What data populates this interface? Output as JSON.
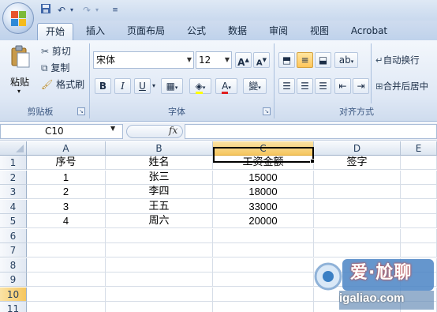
{
  "ribbon_tabs": [
    "开始",
    "插入",
    "页面布局",
    "公式",
    "数据",
    "审阅",
    "视图",
    "Acrobat"
  ],
  "active_tab": "开始",
  "clipboard": {
    "paste_label": "粘贴",
    "cut_label": "剪切",
    "copy_label": "复制",
    "format_painter_label": "格式刷",
    "group_label": "剪贴板"
  },
  "font": {
    "font_name": "宋体",
    "font_size": "12",
    "grow_label": "A",
    "shrink_label": "A",
    "bold": "B",
    "italic": "I",
    "underline": "U",
    "font_color_letter": "A",
    "phonetic_label": "變",
    "group_label": "字体"
  },
  "alignment": {
    "wrap_text_label": "自动换行",
    "merge_label": "合并后居中",
    "group_label": "对齐方式"
  },
  "formula_bar": {
    "name_box": "C10",
    "fx": "fx",
    "formula": ""
  },
  "sheet": {
    "columns": [
      "A",
      "B",
      "C",
      "D",
      "E"
    ],
    "selected_column": "C",
    "rows": [
      "1",
      "2",
      "3",
      "4",
      "5",
      "6",
      "7",
      "8",
      "9",
      "10",
      "11"
    ],
    "selected_row": "10",
    "data": [
      [
        "序号",
        "姓名",
        "工资金额",
        "签字",
        ""
      ],
      [
        "1",
        "张三",
        "15000",
        "",
        ""
      ],
      [
        "2",
        "李四",
        "18000",
        "",
        ""
      ],
      [
        "3",
        "王五",
        "33000",
        "",
        ""
      ],
      [
        "4",
        "周六",
        "20000",
        "",
        ""
      ]
    ]
  },
  "watermark": {
    "text": "爱·尬聊",
    "url": "igaliao.com"
  },
  "colors": {
    "accent": "#f5c65f",
    "ribbon_bg": "#dfe8f5"
  }
}
